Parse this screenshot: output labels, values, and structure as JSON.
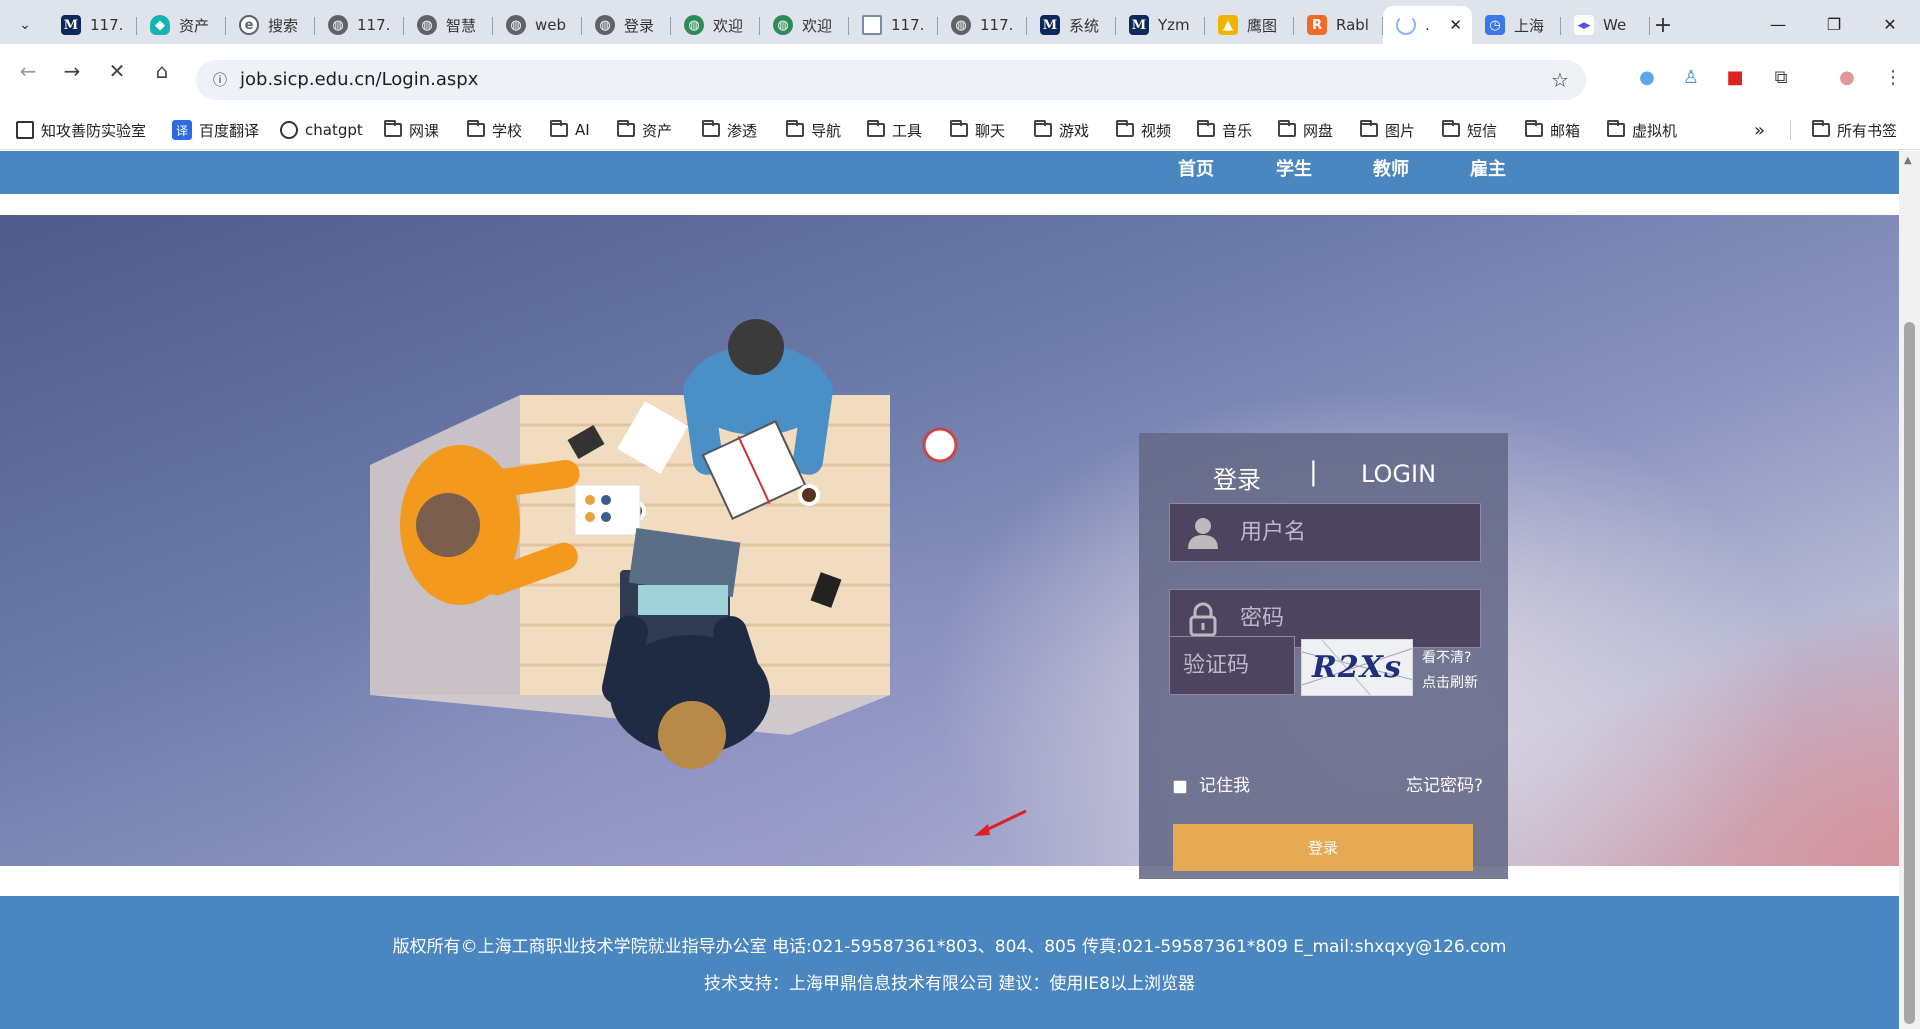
{
  "browser": {
    "tabs": [
      {
        "icon": "m-icon",
        "title": "117."
      },
      {
        "icon": "shield-icon",
        "title": "资产"
      },
      {
        "icon": "search-icon",
        "title": "搜索"
      },
      {
        "icon": "globe-icon",
        "title": "117."
      },
      {
        "icon": "globe-icon",
        "title": "智慧"
      },
      {
        "icon": "globe-icon",
        "title": "web"
      },
      {
        "icon": "globe-icon",
        "title": "登录"
      },
      {
        "icon": "green-globe-icon",
        "title": "欢迎"
      },
      {
        "icon": "green-globe-icon",
        "title": "欢迎"
      },
      {
        "icon": "document-icon",
        "title": "117."
      },
      {
        "icon": "globe-icon",
        "title": "117."
      },
      {
        "icon": "m-icon",
        "title": "系统"
      },
      {
        "icon": "m-icon",
        "title": "Yzm"
      },
      {
        "icon": "eagle-icon",
        "title": "鹰图"
      },
      {
        "icon": "rabbit-icon",
        "title": "Rabl"
      },
      {
        "icon": "loading-icon",
        "title": "."
      },
      {
        "icon": "clock-icon",
        "title": "上海"
      },
      {
        "icon": "wechat-icon",
        "title": "We"
      }
    ],
    "url": "job.sicp.edu.cn/Login.aspx",
    "bookmarks": [
      {
        "icon": "square-icon",
        "label": "知攻善防实验室"
      },
      {
        "icon": "translate-icon",
        "label": "百度翻译"
      },
      {
        "icon": "chatgpt-icon",
        "label": "chatgpt"
      },
      {
        "icon": "folder-icon",
        "label": "网课"
      },
      {
        "icon": "folder-icon",
        "label": "学校"
      },
      {
        "icon": "folder-icon",
        "label": "AI"
      },
      {
        "icon": "folder-icon",
        "label": "资产"
      },
      {
        "icon": "folder-icon",
        "label": "渗透"
      },
      {
        "icon": "folder-icon",
        "label": "导航"
      },
      {
        "icon": "folder-icon",
        "label": "工具"
      },
      {
        "icon": "folder-icon",
        "label": "聊天"
      },
      {
        "icon": "folder-icon",
        "label": "游戏"
      },
      {
        "icon": "folder-icon",
        "label": "视频"
      },
      {
        "icon": "folder-icon",
        "label": "音乐"
      },
      {
        "icon": "folder-icon",
        "label": "网盘"
      },
      {
        "icon": "folder-icon",
        "label": "图片"
      },
      {
        "icon": "folder-icon",
        "label": "短信"
      },
      {
        "icon": "folder-icon",
        "label": "邮箱"
      },
      {
        "icon": "folder-icon",
        "label": "虚拟机"
      }
    ],
    "all_bookmarks": "所有书签",
    "more_glyph": "»"
  },
  "site": {
    "nav": [
      "首页",
      "学生",
      "教师",
      "雇主"
    ],
    "login": {
      "title_cn": "登录",
      "separator": "|",
      "title_en": "LOGIN",
      "username_placeholder": "用户名",
      "password_placeholder": "密码",
      "captcha_placeholder": "验证码",
      "captcha_text": "R2Xs",
      "captcha_hint_1": "看不清?",
      "captcha_hint_2": "点击刷新",
      "remember": "记住我",
      "forgot": "忘记密码?",
      "submit": "登录"
    },
    "footer": {
      "line1": "版权所有©上海工商职业技术学院就业指导办公室    电话:021-59587361*803、804、805 传真:021-59587361*809    E_mail:shxqxy@126.com",
      "line2": "技术支持：上海甲鼎信息技术有限公司 建议：使用IE8以上浏览器"
    }
  },
  "colors": {
    "nav_bar": "#4a86c0",
    "login_button": "#e6a954",
    "login_panel": "#646987"
  }
}
